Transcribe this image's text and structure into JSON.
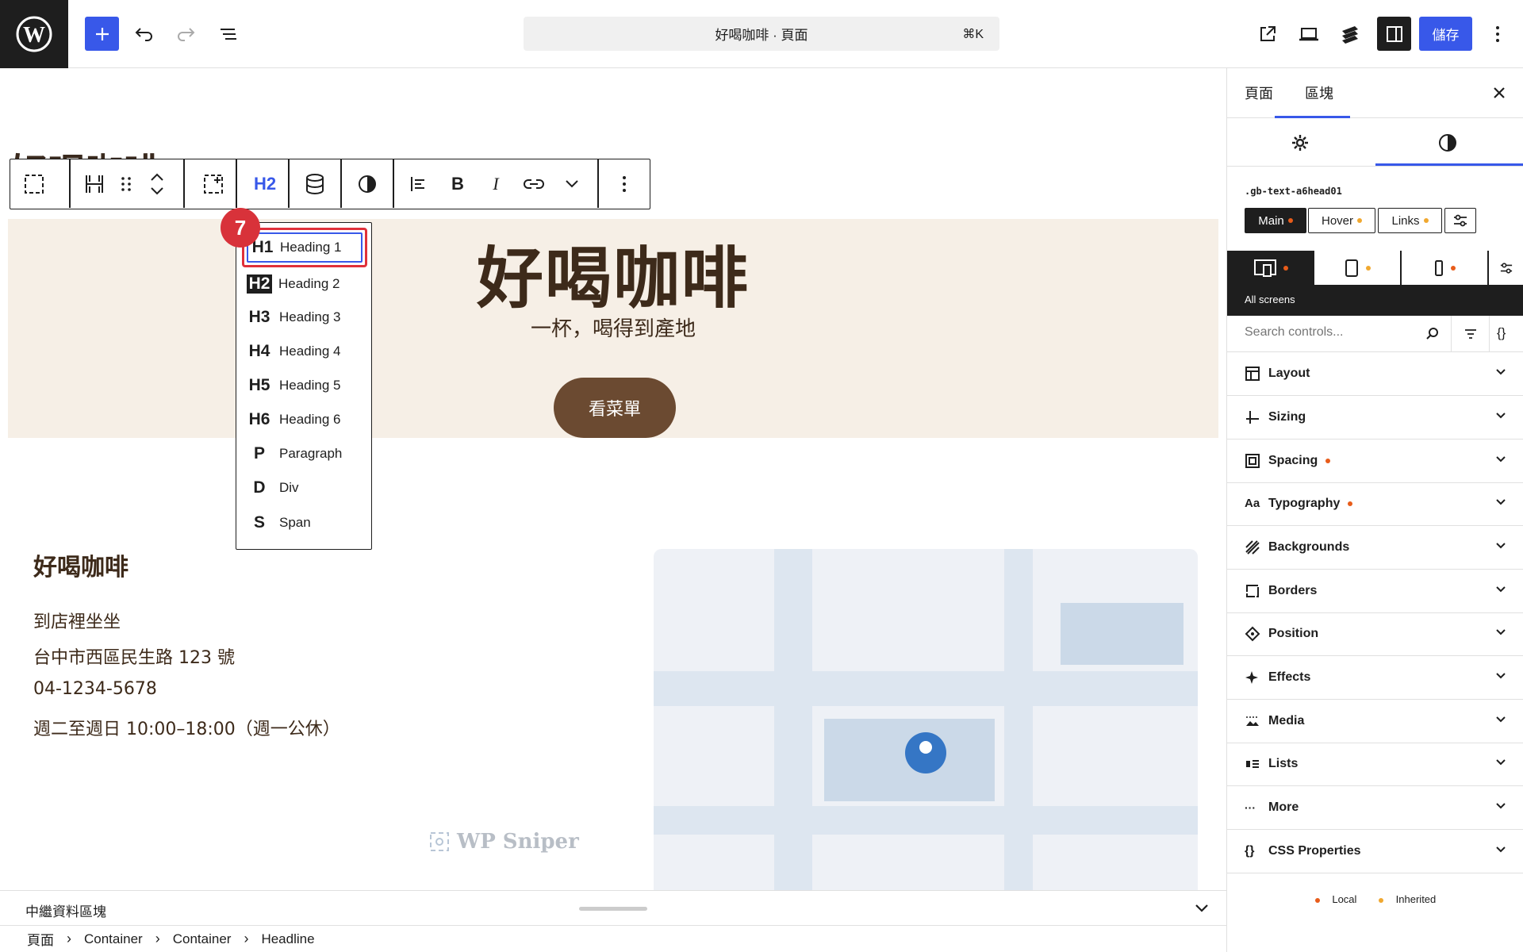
{
  "topbar": {
    "document_title": "好喝咖啡 · 頁面",
    "shortcut": "⌘K",
    "save_label": "儲存"
  },
  "canvas": {
    "behind_title": "好喝咖啡",
    "hero": {
      "title": "好喝咖啡",
      "subtitle": "一杯，喝得到產地",
      "button_label": "看菜單",
      "background": "#f6efe6",
      "button_color": "#6b4a31"
    },
    "info": {
      "title": "好喝咖啡",
      "lines": [
        "到店裡坐坐",
        "台中市西區民生路 123 號",
        "04-1234-5678",
        "週二至週日 10:00–18:00（週一公休）"
      ]
    },
    "watermark": "WP Sniper"
  },
  "block_toolbar": {
    "level_label": "H2"
  },
  "heading_menu": {
    "step_badge": "7",
    "items": [
      {
        "tag": "H1",
        "label": "Heading 1"
      },
      {
        "tag": "H2",
        "label": "Heading 2"
      },
      {
        "tag": "H3",
        "label": "Heading 3"
      },
      {
        "tag": "H4",
        "label": "Heading 4"
      },
      {
        "tag": "H5",
        "label": "Heading 5"
      },
      {
        "tag": "H6",
        "label": "Heading 6"
      },
      {
        "tag": "P",
        "label": "Paragraph"
      },
      {
        "tag": "D",
        "label": "Div"
      },
      {
        "tag": "S",
        "label": "Span"
      }
    ]
  },
  "footer": {
    "relay_label": "中繼資料區塊",
    "breadcrumb": [
      "頁面",
      "Container",
      "Container",
      "Headline"
    ]
  },
  "sidebar": {
    "tabs": [
      "頁面",
      "區塊"
    ],
    "class_name": ".gb-text-a6head01",
    "states": [
      "Main",
      "Hover",
      "Links"
    ],
    "screens_label": "All screens",
    "search_placeholder": "Search controls...",
    "panels": [
      {
        "label": "Layout",
        "icon": "layout-icon",
        "dot": false
      },
      {
        "label": "Sizing",
        "icon": "sizing-icon",
        "dot": false
      },
      {
        "label": "Spacing",
        "icon": "spacing-icon",
        "dot": true
      },
      {
        "label": "Typography",
        "icon": "typography-icon",
        "dot": true
      },
      {
        "label": "Backgrounds",
        "icon": "backgrounds-icon",
        "dot": false
      },
      {
        "label": "Borders",
        "icon": "borders-icon",
        "dot": false
      },
      {
        "label": "Position",
        "icon": "position-icon",
        "dot": false
      },
      {
        "label": "Effects",
        "icon": "effects-icon",
        "dot": false
      },
      {
        "label": "Media",
        "icon": "media-icon",
        "dot": false
      },
      {
        "label": "Lists",
        "icon": "lists-icon",
        "dot": false
      },
      {
        "label": "More",
        "icon": "more-icon",
        "dot": false
      },
      {
        "label": "CSS Properties",
        "icon": "css-properties-icon",
        "dot": false
      }
    ],
    "legend": {
      "local": "Local",
      "inherited": "Inherited"
    },
    "colors": {
      "accent": "#3858e9",
      "local_dot": "#e85c1a",
      "inherited_dot": "#f0a830"
    }
  }
}
